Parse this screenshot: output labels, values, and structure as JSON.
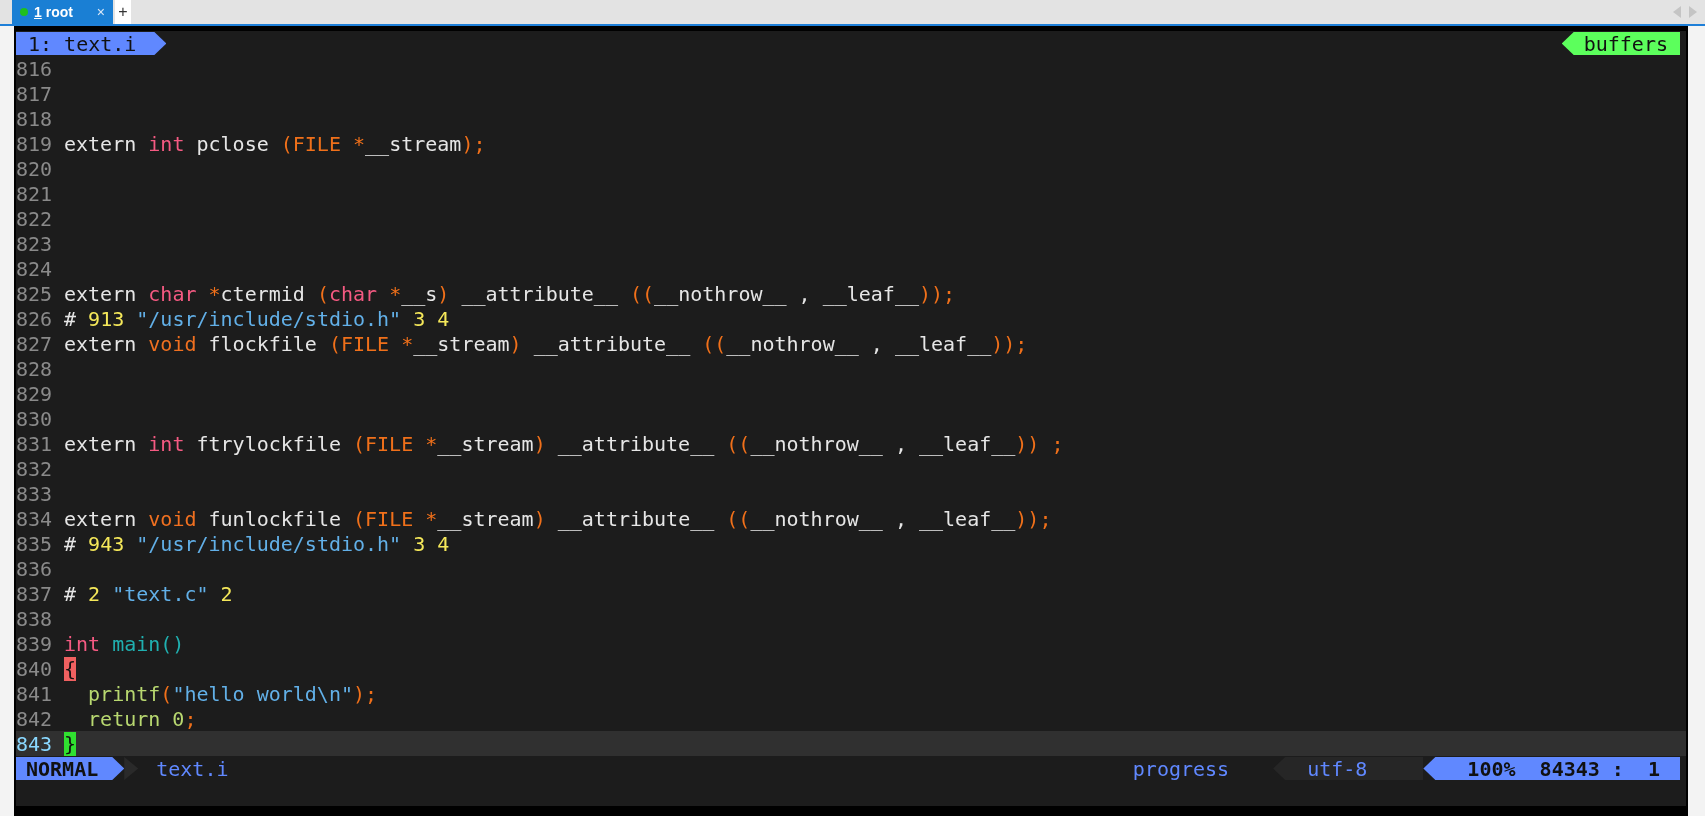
{
  "tabs": [
    {
      "number": "1",
      "label": "root",
      "selected": true,
      "close": "×"
    }
  ],
  "new_tab": "+",
  "vim": {
    "tabline": {
      "buffer": "1: text.i",
      "right_label": "buffers"
    },
    "lines": [
      {
        "number": "816",
        "current": false
      },
      {
        "number": "817",
        "current": false
      },
      {
        "number": "818",
        "current": false
      },
      {
        "number": "819",
        "current": false,
        "tokens": [
          {
            "kind": "plain",
            "text": "extern "
          },
          {
            "kind": "keyword",
            "text": "int"
          },
          {
            "kind": "plain",
            "text": " pclose "
          },
          {
            "kind": "paren",
            "text": "(FILE *"
          },
          {
            "kind": "plain",
            "text": "__stream"
          },
          {
            "kind": "paren",
            "text": ");"
          }
        ]
      },
      {
        "number": "820",
        "current": false
      },
      {
        "number": "821",
        "current": false
      },
      {
        "number": "822",
        "current": false
      },
      {
        "number": "823",
        "current": false
      },
      {
        "number": "824",
        "current": false
      },
      {
        "number": "825",
        "current": false,
        "tokens": [
          {
            "kind": "plain",
            "text": "extern "
          },
          {
            "kind": "keyword",
            "text": "char"
          },
          {
            "kind": "paren",
            "text": " *"
          },
          {
            "kind": "plain",
            "text": "ctermid "
          },
          {
            "kind": "paren",
            "text": "("
          },
          {
            "kind": "keyword",
            "text": "char"
          },
          {
            "kind": "paren",
            "text": " *"
          },
          {
            "kind": "plain",
            "text": "__s"
          },
          {
            "kind": "paren",
            "text": ")"
          },
          {
            "kind": "plain",
            "text": " __attribute__ "
          },
          {
            "kind": "paren",
            "text": "(("
          },
          {
            "kind": "plain",
            "text": "__nothrow__ , __leaf__"
          },
          {
            "kind": "paren",
            "text": "));"
          }
        ]
      },
      {
        "number": "826",
        "current": false,
        "tokens": [
          {
            "kind": "plain",
            "text": "# "
          },
          {
            "kind": "number",
            "text": "913"
          },
          {
            "kind": "string",
            "text": " \"/usr/include/stdio.h\""
          },
          {
            "kind": "number",
            "text": " 3 4"
          }
        ]
      },
      {
        "number": "827",
        "current": false,
        "tokens": [
          {
            "kind": "plain",
            "text": "extern "
          },
          {
            "kind": "storage",
            "text": "void"
          },
          {
            "kind": "plain",
            "text": " flockfile "
          },
          {
            "kind": "paren",
            "text": "(FILE *"
          },
          {
            "kind": "plain",
            "text": "__stream"
          },
          {
            "kind": "paren",
            "text": ")"
          },
          {
            "kind": "plain",
            "text": " __attribute__ "
          },
          {
            "kind": "paren",
            "text": "(("
          },
          {
            "kind": "plain",
            "text": "__nothrow__ , __leaf__"
          },
          {
            "kind": "paren",
            "text": "));"
          }
        ]
      },
      {
        "number": "828",
        "current": false
      },
      {
        "number": "829",
        "current": false
      },
      {
        "number": "830",
        "current": false
      },
      {
        "number": "831",
        "current": false,
        "tokens": [
          {
            "kind": "plain",
            "text": "extern "
          },
          {
            "kind": "keyword",
            "text": "int"
          },
          {
            "kind": "plain",
            "text": " ftrylockfile "
          },
          {
            "kind": "paren",
            "text": "(FILE *"
          },
          {
            "kind": "plain",
            "text": "__stream"
          },
          {
            "kind": "paren",
            "text": ")"
          },
          {
            "kind": "plain",
            "text": " __attribute__ "
          },
          {
            "kind": "paren",
            "text": "(("
          },
          {
            "kind": "plain",
            "text": "__nothrow__ , __leaf__"
          },
          {
            "kind": "paren",
            "text": ")) ;"
          }
        ]
      },
      {
        "number": "832",
        "current": false
      },
      {
        "number": "833",
        "current": false
      },
      {
        "number": "834",
        "current": false,
        "tokens": [
          {
            "kind": "plain",
            "text": "extern "
          },
          {
            "kind": "storage",
            "text": "void"
          },
          {
            "kind": "plain",
            "text": " funlockfile "
          },
          {
            "kind": "paren",
            "text": "(FILE *"
          },
          {
            "kind": "plain",
            "text": "__stream"
          },
          {
            "kind": "paren",
            "text": ")"
          },
          {
            "kind": "plain",
            "text": " __attribute__ "
          },
          {
            "kind": "paren",
            "text": "(("
          },
          {
            "kind": "plain",
            "text": "__nothrow__ , __leaf__"
          },
          {
            "kind": "paren",
            "text": "));"
          }
        ]
      },
      {
        "number": "835",
        "current": false,
        "tokens": [
          {
            "kind": "plain",
            "text": "# "
          },
          {
            "kind": "number",
            "text": "943"
          },
          {
            "kind": "string",
            "text": " \"/usr/include/stdio.h\""
          },
          {
            "kind": "number",
            "text": " 3 4"
          }
        ]
      },
      {
        "number": "836",
        "current": false
      },
      {
        "number": "837",
        "current": false,
        "tokens": [
          {
            "kind": "plain",
            "text": "# "
          },
          {
            "kind": "number",
            "text": "2"
          },
          {
            "kind": "string",
            "text": " \"text.c\""
          },
          {
            "kind": "number",
            "text": " 2"
          }
        ]
      },
      {
        "number": "838",
        "current": false
      },
      {
        "number": "839",
        "current": false,
        "tokens": [
          {
            "kind": "keyword",
            "text": "int"
          },
          {
            "kind": "func",
            "text": " main()"
          }
        ]
      },
      {
        "number": "840",
        "current": false,
        "tokens": [
          {
            "kind": "match",
            "text": "{"
          }
        ]
      },
      {
        "number": "841",
        "current": false,
        "tokens": [
          {
            "kind": "call",
            "text": "  printf"
          },
          {
            "kind": "paren",
            "text": "("
          },
          {
            "kind": "string",
            "text": "\"hello world\\n\""
          },
          {
            "kind": "paren",
            "text": ");"
          }
        ]
      },
      {
        "number": "842",
        "current": false,
        "tokens": [
          {
            "kind": "call",
            "text": "  return 0"
          },
          {
            "kind": "paren",
            "text": ";"
          }
        ]
      },
      {
        "number": "843",
        "current": true,
        "tokens": [
          {
            "kind": "cursor",
            "text": "}"
          }
        ]
      }
    ],
    "status": {
      "mode": "NORMAL",
      "file": "text.i",
      "section": "progress",
      "encoding": "utf-8",
      "position": "100%  84343 :  1"
    }
  }
}
